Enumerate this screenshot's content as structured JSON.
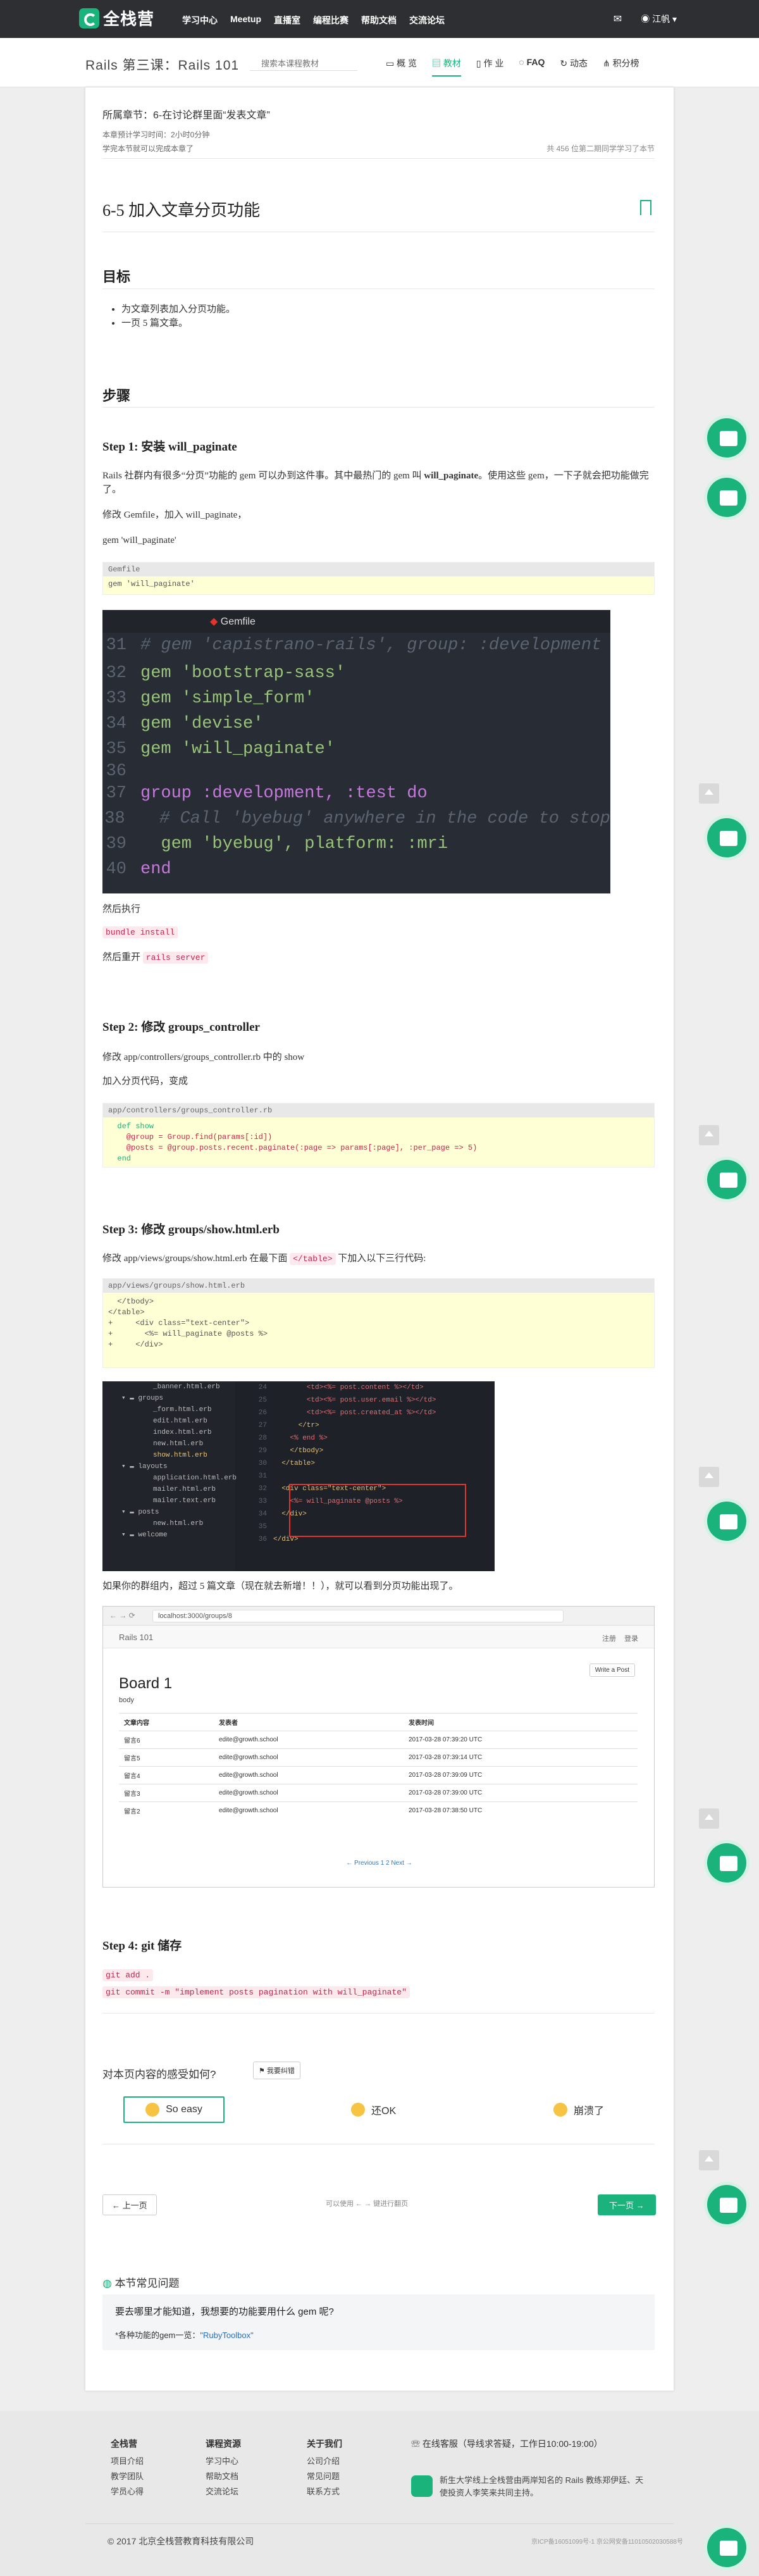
{
  "topnav": {
    "logo": "全栈营",
    "links": [
      "学习中心",
      "Meetup",
      "直播室",
      "编程比赛",
      "帮助文档",
      "交流论坛"
    ],
    "user": "江帆 ▾"
  },
  "course": {
    "title": "Rails 第三课：Rails 101",
    "search_placeholder": "搜索本课程教材",
    "tabs": [
      "概 览",
      "教材",
      "作 业",
      "FAQ",
      "动态",
      "积分榜"
    ]
  },
  "section": {
    "chapter": "所属章节：6-在讨论群里面“发表文章”",
    "time": "本章预计学习时间：2小时0分钟",
    "progress_note": "学完本节就可以完成本章了",
    "learners": "共 456 位第二期同学学习了本节",
    "title": "6-5 加入文章分页功能"
  },
  "goal": {
    "heading": "目标",
    "items": [
      "为文章列表加入分页功能。",
      "一页 5 篇文章。"
    ]
  },
  "steps_heading": "步骤",
  "step1": {
    "title": "Step 1: 安装 will_paginate",
    "p1_a": "Rails 社群内有很多“分页”功能的 gem 可以办到这件事。其中最热门的 gem 叫 ",
    "p1_b": "will_paginate",
    "p1_c": "。使用这些 gem，一下子就会把功能做完了。",
    "p2": "修改 Gemfile，加入 will_paginate，",
    "p3": "gem 'will_paginate'",
    "code_cap": "Gemfile",
    "code": "gem 'will_paginate'",
    "editor_title": "Gemfile",
    "run": "然后执行",
    "cmd1": "bundle install",
    "restart": "然后重开",
    "cmd2": "rails server"
  },
  "editor1": {
    "lines": [
      {
        "n": "31",
        "t": "# gem 'capistrano-rails', group: :development"
      },
      {
        "n": "32",
        "t": "gem 'bootstrap-sass'"
      },
      {
        "n": "33",
        "t": "gem 'simple_form'"
      },
      {
        "n": "34",
        "t": "gem 'devise'"
      },
      {
        "n": "35",
        "t": "gem 'will_paginate'"
      },
      {
        "n": "36",
        "t": ""
      },
      {
        "n": "37",
        "t": "group :development, :test do"
      },
      {
        "n": "38",
        "t": "  # Call 'byebug' anywhere in the code to stop"
      },
      {
        "n": "39",
        "t": "  gem 'byebug', platform: :mri"
      },
      {
        "n": "40",
        "t": "end"
      }
    ]
  },
  "step2": {
    "title": "Step 2: 修改 groups_controller",
    "p1": "修改 app/controllers/groups_controller.rb 中的 show",
    "p2": "加入分页代码，变成",
    "code_cap": "app/controllers/groups_controller.rb",
    "code_lines": [
      "  def show",
      "    @group = Group.find(params[:id])",
      "    @posts = @group.posts.recent.paginate(:page => params[:page], :per_page => 5)",
      "  end"
    ]
  },
  "step3": {
    "title": "Step 3: 修改 groups/show.html.erb",
    "p1_a": "修改 app/views/groups/show.html.erb 在最下面 ",
    "p1_code": "</table>",
    "p1_b": " 下加入以下三行代码:",
    "code_cap": "app/views/groups/show.html.erb",
    "code_lines": [
      "  </tbody>",
      "</table>",
      "",
      "+     <div class=\"text-center\">",
      "+       <%= will_paginate @posts %>",
      "+     </div>"
    ],
    "after": "如果你的群组内，超过 5 篇文章（现在就去新增！！），就可以看到分页功能出现了。"
  },
  "editor2": {
    "tree": [
      "_banner.html.erb",
      "groups",
      "_form.html.erb",
      "edit.html.erb",
      "index.html.erb",
      "new.html.erb",
      "show.html.erb",
      "layouts",
      "application.html.erb",
      "mailer.html.erb",
      "mailer.text.erb",
      "posts",
      "new.html.erb",
      "welcome"
    ],
    "gutter": [
      "24",
      "25",
      "26",
      "27",
      "28",
      "29",
      "30",
      "31",
      "32",
      "33",
      "34",
      "35",
      "36"
    ],
    "code": [
      "        <td><%= post.content %></td>",
      "        <td><%= post.user.email %></td>",
      "        <td><%= post.created_at %></td>",
      "      </tr>",
      "    <% end %>",
      "    </tbody>",
      "  </table>",
      "",
      "  <div class=\"text-center\">",
      "    <%= will_paginate @posts %>",
      "  </div>",
      "",
      "</div>"
    ]
  },
  "browser": {
    "url": "localhost:3000/groups/8",
    "brand": "Rails 101",
    "nav_right": [
      "注册",
      "登录"
    ],
    "write": "Write a Post",
    "board": "Board 1",
    "desc": "body",
    "cols": [
      "文章内容",
      "发表者",
      "发表时间"
    ],
    "rows": [
      [
        "留言6",
        "edite@growth.school",
        "2017-03-28 07:39:20 UTC"
      ],
      [
        "留言5",
        "edite@growth.school",
        "2017-03-28 07:39:14 UTC"
      ],
      [
        "留言4",
        "edite@growth.school",
        "2017-03-28 07:39:09 UTC"
      ],
      [
        "留言3",
        "edite@growth.school",
        "2017-03-28 07:39:00 UTC"
      ],
      [
        "留言2",
        "edite@growth.school",
        "2017-03-28 07:38:50 UTC"
      ]
    ],
    "pager": "← Previous 1 2 Next →"
  },
  "step4": {
    "title": "Step 4: git 储存",
    "cmd1": "git add .",
    "cmd2": "git commit -m \"implement posts pagination with will_paginate\""
  },
  "feedback": {
    "question": "对本页内容的感受如何?",
    "report": "我要纠错",
    "options": [
      "So easy",
      "还OK",
      "崩溃了"
    ]
  },
  "pager": {
    "prev": "上一页",
    "hint": "可以使用 ← → 键进行翻页",
    "next": "下一页"
  },
  "faq": {
    "heading": "本节常见问题",
    "q": "要去哪里才能知道，我想要的功能要用什么 gem 呢?",
    "a_prefix": "*各种功能的gem一览：",
    "a_link": "\"RubyToolbox\""
  },
  "footer": {
    "cols": [
      {
        "h": "全栈营",
        "items": [
          "项目介绍",
          "教学团队",
          "学员心得"
        ]
      },
      {
        "h": "课程资源",
        "items": [
          "学习中心",
          "帮助文档",
          "交流论坛"
        ]
      },
      {
        "h": "关于我们",
        "items": [
          "公司介绍",
          "常见问题",
          "联系方式"
        ]
      }
    ],
    "service": "在线客服（导线求答疑，工作日10:00-19:00）",
    "slogan": "新生大学线上全栈营由两岸知名的 Rails 教练郑伊廷、天使投资人李笑来共同主持。",
    "copyright": "© 2017 北京全栈营教育科技有限公司",
    "icp": "京ICP备16051099号-1 京公网安备11010502030588号"
  },
  "colors": {
    "accent": "#1bb37c",
    "nav": "#2e2f32"
  }
}
